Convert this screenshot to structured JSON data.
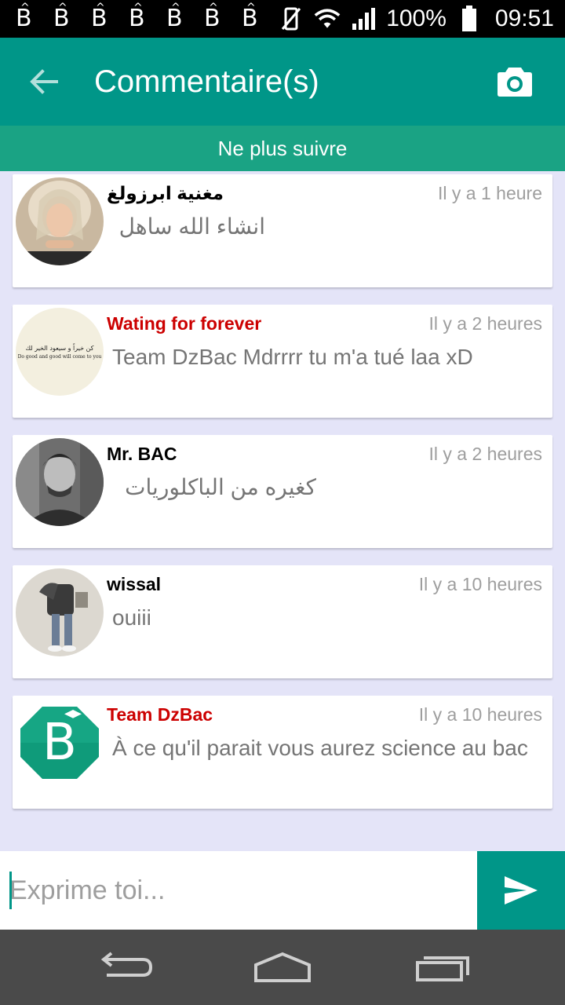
{
  "status_bar": {
    "notification_icons": [
      "B",
      "B",
      "B",
      "B",
      "B",
      "B",
      "B"
    ],
    "battery": "100%",
    "time": "09:51"
  },
  "app_bar": {
    "title": "Commentaire(s)"
  },
  "follow_bar": {
    "label": "Ne plus suivre"
  },
  "comments": [
    {
      "author": "مغنية ابرزولغ",
      "author_color": "#000000",
      "time": "Il y a 1 heure",
      "text": "انشاء الله ساهل",
      "rtl": true
    },
    {
      "author": "Wating for forever",
      "author_color": "#cc0000",
      "time": "Il y a 2 heures",
      "text": "Team DzBac Mdrrrr tu m'a tué laa xD",
      "rtl": false,
      "avatar_text_ar": "كن خيراً و سيعود الخير لك",
      "avatar_text_en": "Do good and good will come to you"
    },
    {
      "author": "Mr. BAC",
      "author_color": "#000000",
      "time": "Il y a 2 heures",
      "text": "كغيره من الباكلوريات",
      "rtl": true
    },
    {
      "author": "wissal",
      "author_color": "#000000",
      "time": "Il y a 10 heures",
      "text": "ouiii",
      "rtl": false
    },
    {
      "author": "Team DzBac",
      "author_color": "#cc0000",
      "time": "Il y a 10 heures",
      "text": "À ce qu'il parait vous aurez science au bac",
      "rtl": false,
      "avatar_logo": "B"
    }
  ],
  "input": {
    "placeholder": "Exprime toi..."
  },
  "colors": {
    "primary": "#009688",
    "follow_bar": "#1aa384",
    "background": "#e4e4f8",
    "highlight_author": "#cc0000"
  }
}
